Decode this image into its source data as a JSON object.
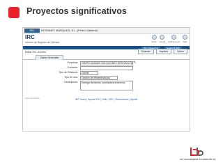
{
  "slide": {
    "title": "Proyectos significativos"
  },
  "app": {
    "logo_small": "IRC",
    "logo_text": "INTRANET MARQUES, S.L. (Pedro Gallardo)",
    "title": "IRC",
    "subtitle": "Informe de Registro de Clientes",
    "icons": [
      {
        "name": "home-icon",
        "label": "Inicio"
      },
      {
        "name": "help-icon",
        "label": "Ayuda"
      },
      {
        "name": "apps-icon",
        "label": "Aplicaciones"
      },
      {
        "name": "logout-icon",
        "label": "Salir"
      }
    ],
    "banner_tabs": [
      "IRC profesional",
      "Gestionar IRC"
    ]
  },
  "breadcrumb": "Editar IRC: Andrés",
  "tab": "Datos Generales",
  "toolbar": {
    "save": "Guardar",
    "print": "Imprimir",
    "back": "Volver"
  },
  "form": {
    "rows": [
      {
        "label": "Empresa:",
        "value": "GRUPO ADAMAS SOLUCIONES INTEGRALES S.L. Y"
      },
      {
        "label": "Contacto:",
        "value": ""
      },
      {
        "label": "Tipo de Relación:",
        "value": "Cliente"
      },
      {
        "label": "Tipo de uso:",
        "value": "Gestión de Infraestructuras"
      },
      {
        "label": "Descripción:",
        "value": "Entrega de bienes, suministros a terceros"
      }
    ]
  },
  "footer": {
    "left": "Soporte técnico",
    "links": "IRC Inicio  |  Ayuda IRC  |  Salir  |  IRC  |  Seleccionar  |  Ayuda"
  },
  "brand": {
    "text": "ver aconsejable en www.bb.es"
  }
}
